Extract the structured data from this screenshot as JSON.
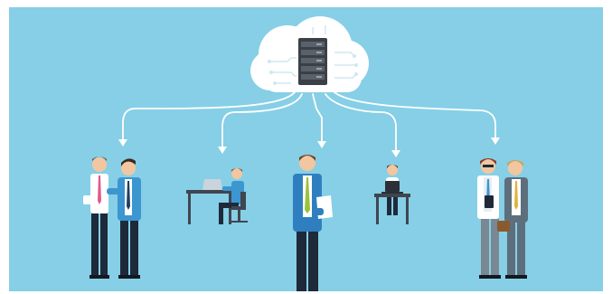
{
  "scene": {
    "background_color": "#86cfe6",
    "cloud_color": "#ffffff",
    "server_color": "#3b3f46",
    "arrow_color": "#ffffff",
    "desk_color": "#3f4650",
    "suit_blue": "#2f7fc0",
    "pants_dark": "#1e2a3a",
    "skin": "#f2c6a0",
    "hair_brown": "#6b4426",
    "icons": [
      "cloud-icon",
      "server-icon",
      "arrow-icon",
      "person-icon",
      "desk-icon",
      "laptop-icon",
      "chair-icon"
    ]
  }
}
